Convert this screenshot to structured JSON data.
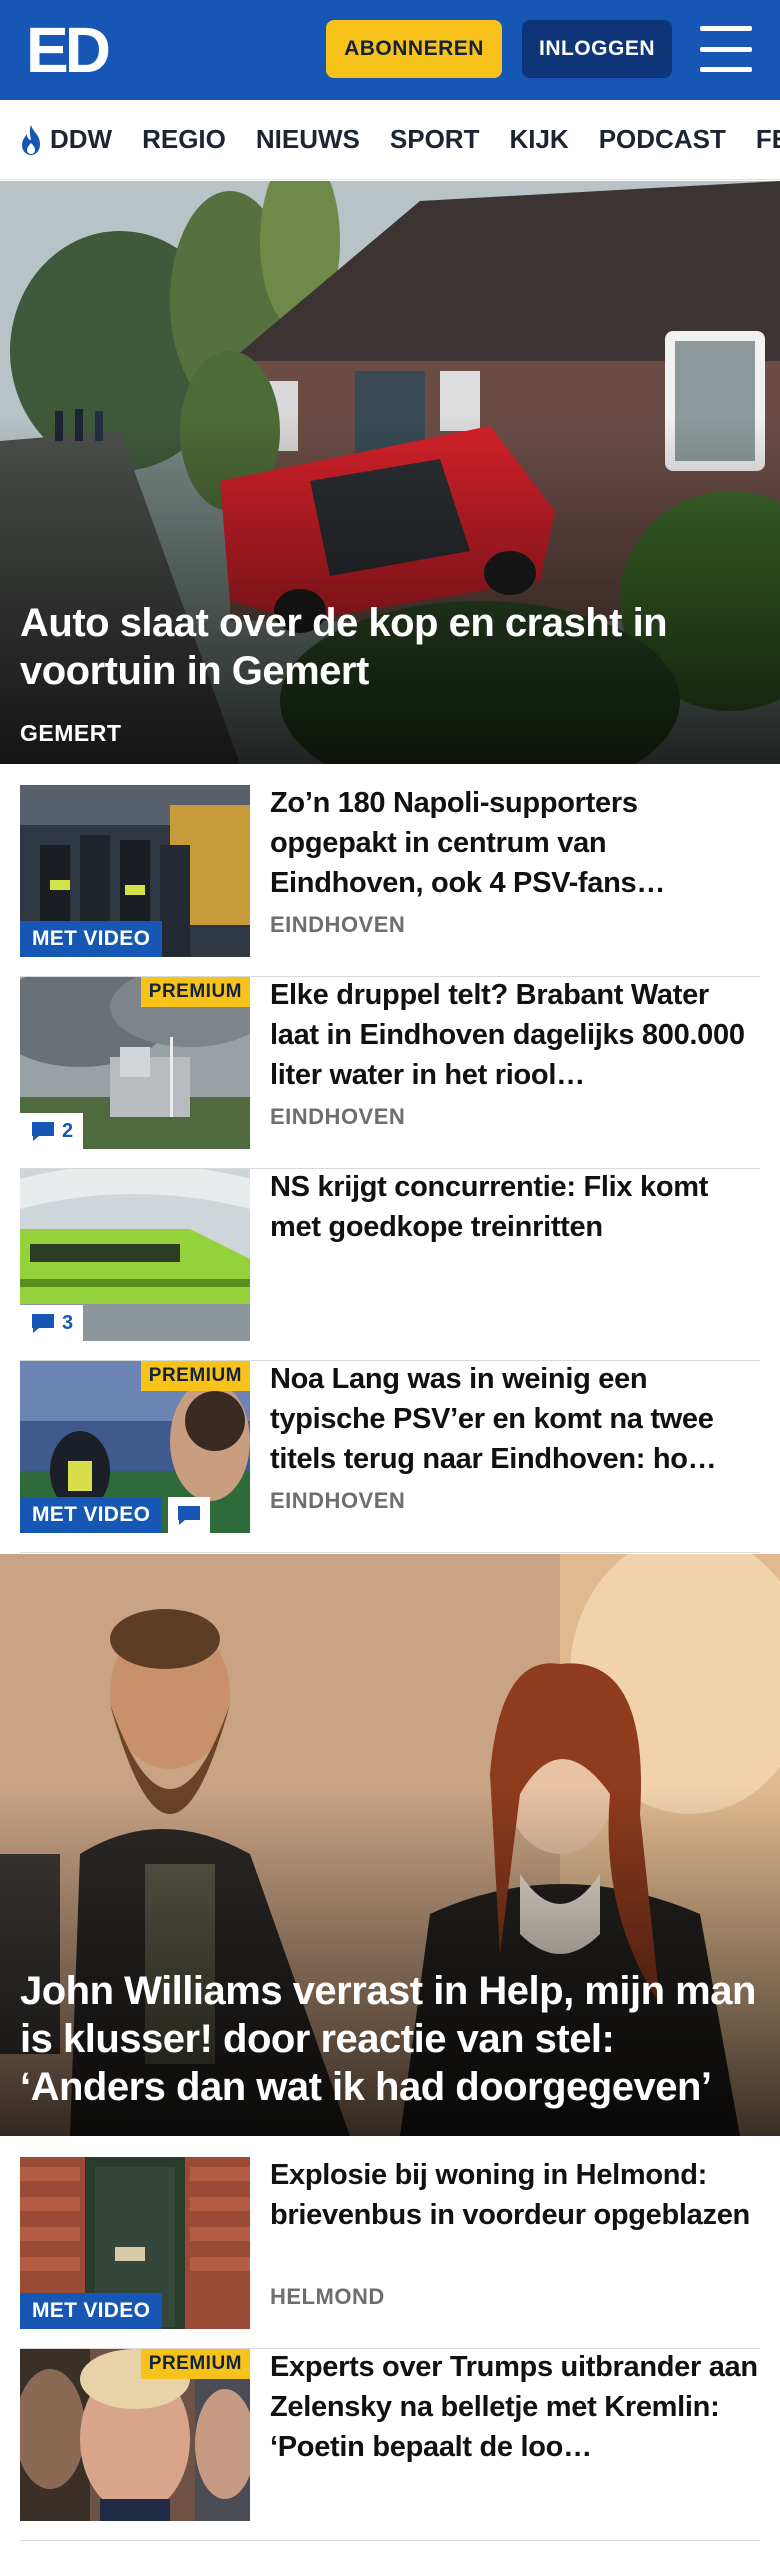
{
  "header": {
    "logo": "ED",
    "subscribe_label": "ABONNEREN",
    "login_label": "INLOGGEN",
    "menu_icon": "hamburger-menu-icon",
    "colors": {
      "brand": "#1657b5",
      "accent": "#f7c21a",
      "login_bg": "#0e3578"
    }
  },
  "nav": {
    "items": [
      {
        "label": "DDW",
        "icon": "flame-icon"
      },
      {
        "label": "REGIO"
      },
      {
        "label": "NIEUWS"
      },
      {
        "label": "SPORT"
      },
      {
        "label": "KIJK"
      },
      {
        "label": "PODCAST"
      },
      {
        "label": "FEE"
      }
    ]
  },
  "hero1": {
    "title": "Auto slaat over de kop en crasht in voortuin in Gemert",
    "place": "GEMERT"
  },
  "articles1": [
    {
      "title": "Zo’n 180 Napoli-supporters opgepakt in centrum van Eindhoven, ook 4 PSV-fans…",
      "place": "EINDHOVEN",
      "video_label": "MET VIDEO"
    },
    {
      "title": "Elke druppel telt? Brabant Water laat in Eindhoven dagelijks 800.000 liter water in het riool…",
      "place": "EINDHOVEN",
      "premium_label": "PREMIUM",
      "comments": "2"
    },
    {
      "title": "NS krijgt concurrentie: Flix komt met goedkope treinritten",
      "comments": "3"
    },
    {
      "title": "Noa Lang was in weinig een typische PSV’er en komt na twee titels terug naar Eindhoven: ho…",
      "place": "EINDHOVEN",
      "premium_label": "PREMIUM",
      "video_label": "MET VIDEO"
    }
  ],
  "hero2": {
    "title": "John Williams verrast in Help, mijn man is klusser! door reactie van stel: ‘Anders dan wat ik had doorgegeven’"
  },
  "articles2": [
    {
      "title": "Explosie bij woning in Helmond: brievenbus in voordeur opgeblazen",
      "place": "HELMOND",
      "video_label": "MET VIDEO"
    },
    {
      "title": "Experts over Trumps uitbrander aan Zelensky na belletje met Kremlin: ‘Poetin bepaalt de loo…",
      "premium_label": "PREMIUM"
    }
  ]
}
